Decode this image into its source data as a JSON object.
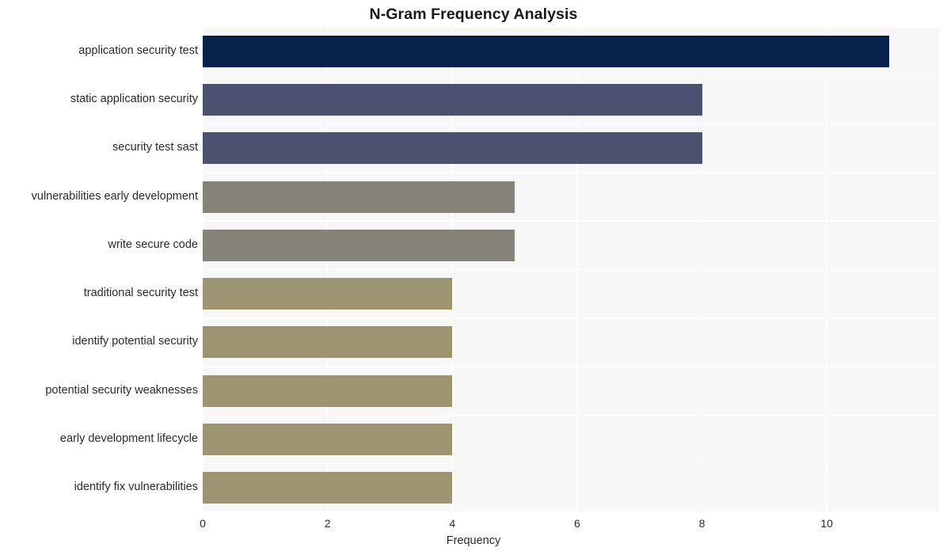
{
  "chart_data": {
    "type": "bar",
    "orientation": "horizontal",
    "title": "N-Gram Frequency Analysis",
    "xlabel": "Frequency",
    "ylabel": "",
    "categories": [
      "application security test",
      "static application security",
      "security test sast",
      "vulnerabilities early development",
      "write secure code",
      "traditional security test",
      "identify potential security",
      "potential security weaknesses",
      "early development lifecycle",
      "identify fix vulnerabilities"
    ],
    "values": [
      11,
      8,
      8,
      5,
      5,
      4,
      4,
      4,
      4,
      4
    ],
    "bar_colors": [
      "#04224c",
      "#4a5270",
      "#4a5270",
      "#85837a",
      "#85837a",
      "#9d9472",
      "#9d9472",
      "#9d9472",
      "#9d9472",
      "#9d9472"
    ],
    "xlim": [
      0,
      11.8
    ],
    "xticks": [
      0,
      2,
      4,
      6,
      8,
      10
    ],
    "xtick_labels": [
      "0",
      "2",
      "4",
      "6",
      "8",
      "10"
    ],
    "grid": true,
    "grid_color": "#ffffff",
    "plot_background": "#f7f7f7",
    "figure_background": "#ffffff",
    "legend": null
  }
}
